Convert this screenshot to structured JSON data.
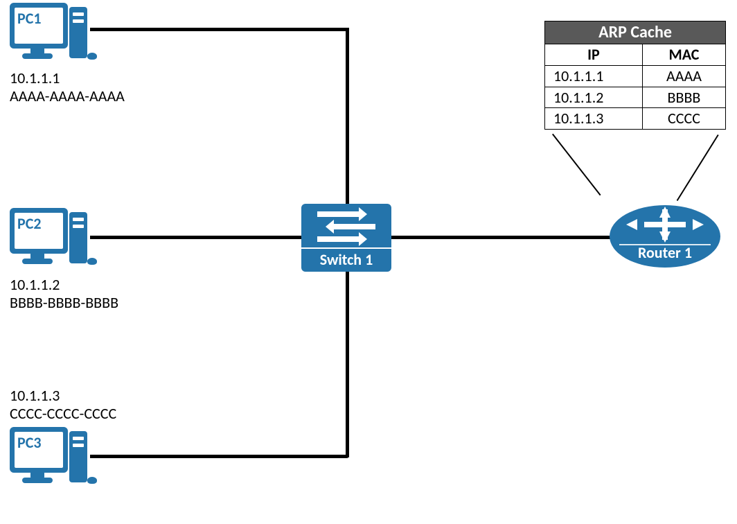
{
  "devices": {
    "pc1": {
      "name": "PC1",
      "ip": "10.1.1.1",
      "mac": "AAAA-AAAA-AAAA"
    },
    "pc2": {
      "name": "PC2",
      "ip": "10.1.1.2",
      "mac": "BBBB-BBBB-BBBB"
    },
    "pc3": {
      "name": "PC3",
      "ip": "10.1.1.3",
      "mac": "CCCC-CCCC-CCCC"
    },
    "switch1": {
      "label": "Switch 1"
    },
    "router1": {
      "label": "Router 1"
    }
  },
  "arp_table": {
    "title": "ARP Cache",
    "col_ip": "IP",
    "col_mac": "MAC",
    "rows": [
      {
        "ip": "10.1.1.1",
        "mac": "AAAA"
      },
      {
        "ip": "10.1.1.2",
        "mac": "BBBB"
      },
      {
        "ip": "10.1.1.3",
        "mac": "CCCC"
      }
    ]
  }
}
